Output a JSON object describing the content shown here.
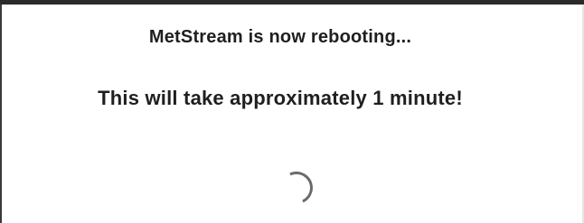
{
  "dialog": {
    "title": "MetStream is now rebooting...",
    "message": "This will take approximately 1 minute!"
  },
  "loading": {
    "icon": "loading-spinner-icon",
    "accent_color": "#6a6a6a"
  }
}
